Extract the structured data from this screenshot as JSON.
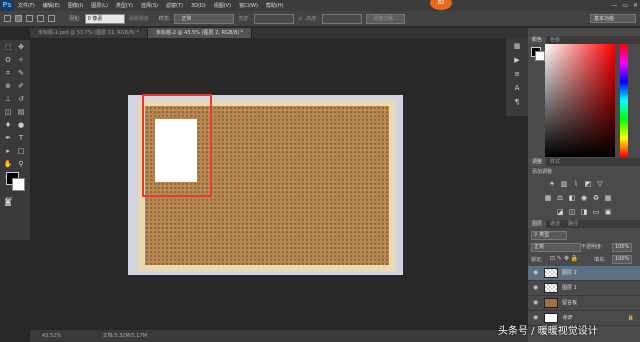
{
  "app": {
    "logo": "Ps"
  },
  "menu": [
    "文件(F)",
    "编辑(E)",
    "图像(I)",
    "图层(L)",
    "类型(Y)",
    "选择(S)",
    "滤镜(T)",
    "3D(D)",
    "视图(V)",
    "窗口(W)",
    "帮助(H)"
  ],
  "window_controls": {
    "minimize": "—",
    "restore": "▭",
    "close": "✕"
  },
  "badge": "82",
  "options": {
    "feather_label": "羽化:",
    "feather_value": "0 像素",
    "antialias_label": "消除锯齿",
    "style_label": "样式:",
    "style_value": "正常",
    "width_label": "宽度:",
    "height_label": "高度:",
    "refine_edge": "调整边缘...",
    "workspace": "基本功能"
  },
  "tabs": [
    {
      "label": "未标题-1.psd @ 53.7% (图层 11, RGB/8) *",
      "active": false
    },
    {
      "label": "未标题-2 @ 43.5% (图层 2, RGB/8) *",
      "active": true
    }
  ],
  "status": {
    "zoom": "43.52%",
    "doc": "文档:5.32M/5.17M"
  },
  "panels": {
    "color_tabs": [
      "颜色",
      "色板"
    ],
    "adjust_tabs": [
      "调整",
      "样式"
    ],
    "adjust_title": "添加调整",
    "layers_tabs": [
      "图层",
      "通道",
      "路径"
    ],
    "kind_label": "类型",
    "blend_mode": "正常",
    "opacity_label": "不透明度:",
    "opacity_value": "100%",
    "lock_label": "锁定:",
    "fill_label": "填充:",
    "fill_value": "100%"
  },
  "layers": [
    {
      "name": "图层 2",
      "thumb": "checker",
      "selected": true
    },
    {
      "name": "图层 1",
      "thumb": "checker",
      "selected": false
    },
    {
      "name": "留言板",
      "thumb": "cork",
      "selected": false
    },
    {
      "name": "背景",
      "thumb": "white",
      "selected": false
    }
  ],
  "watermark": "头条号 / 暖暖视觉设计",
  "colors": {
    "accent_red": "#e53935",
    "selected_layer": "#5d7184",
    "badge": "#e86a1a"
  }
}
